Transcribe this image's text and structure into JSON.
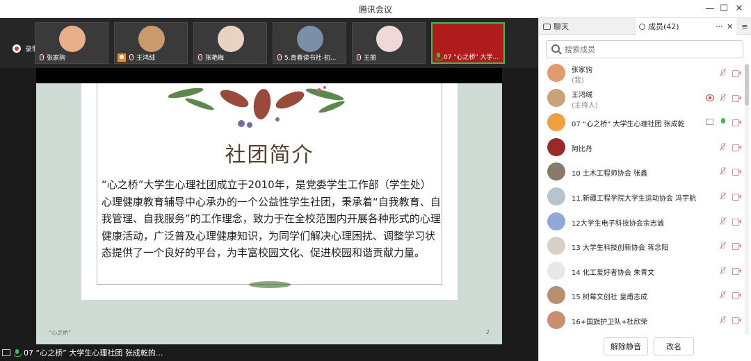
{
  "window": {
    "title": "腾讯会议"
  },
  "recording": {
    "label": "录制中"
  },
  "video_strip": [
    {
      "name": "张家驹",
      "avatar_color": "#e8b08a",
      "host": false,
      "active": false
    },
    {
      "name": "王鸿绒",
      "avatar_color": "#c99a6a",
      "host": true,
      "active": false
    },
    {
      "name": "张艳梅",
      "avatar_color": "#e8d2c4",
      "host": false,
      "active": false
    },
    {
      "name": "5.青春读书社-初...",
      "avatar_color": "#7b8fa6",
      "host": false,
      "active": false
    },
    {
      "name": "王丽",
      "avatar_color": "#efd8d8",
      "host": false,
      "active": false
    },
    {
      "name": "07 \"心之桥\" 大学...",
      "avatar_color": "#b01c1c",
      "host": false,
      "active": true
    }
  ],
  "slide": {
    "title": "社团简介",
    "body": "“心之桥”大学生心理社团成立于2010年，是党委学生工作部（学生处）心理健康教育辅导中心承办的一个公益性学生社团，秉承着“自我教育、自我管理、自我服务”的工作理念，致力于在全校范围内开展各种形式的心理健康活动，广泛普及心理健康知识，为同学们解决心理困扰、调整学习状态提供了一个良好的平台，为丰富校园文化、促进校园和谐贡献力量。",
    "footer_left": "“心之桥”",
    "page_number": "2"
  },
  "speaker": {
    "label": "07 “心之桥” 大学生心理社团  张成乾的..."
  },
  "panel": {
    "tab_chat": "聊天",
    "tab_members": "成员(42)",
    "more": "···",
    "close": "✕",
    "menu": "≡",
    "search_placeholder": "搜索成员",
    "members": [
      {
        "name": "张家驹",
        "role": "(我)",
        "avatar_color": "#e39a6c",
        "state": "muted"
      },
      {
        "name": "王鸿绒",
        "role": "(主持人)",
        "avatar_color": "#c9a27a",
        "state": "host"
      },
      {
        "name": "07 “心之桥” 大学生心理社团  张成乾",
        "role": "",
        "avatar_color": "#f0a040",
        "state": "speaking"
      },
      {
        "name": "阿比丹",
        "role": "",
        "avatar_color": "#9a2a2a",
        "state": "muted"
      },
      {
        "name": "10 土木工程师协会 张鑫",
        "role": "",
        "avatar_color": "#8a7a6a",
        "state": "muted"
      },
      {
        "name": "11.新疆工程学院大学生运动协会 冯宇航",
        "role": "",
        "avatar_color": "#b8c4cc",
        "state": "muted"
      },
      {
        "name": "12大学生电子科技协会余志诚",
        "role": "",
        "avatar_color": "#8fa8d8",
        "state": "muted"
      },
      {
        "name": "13 大学生科技创新协会 蒋念阳",
        "role": "",
        "avatar_color": "#d8d0c8",
        "state": "muted"
      },
      {
        "name": "14 化工爱好者协会 朱青文",
        "role": "",
        "avatar_color": "#e8e8e8",
        "state": "muted"
      },
      {
        "name": "15 树莓文创社 皇甫志成",
        "role": "",
        "avatar_color": "#b89070",
        "state": "muted"
      },
      {
        "name": "16+国旗护卫队+杜欣荣",
        "role": "",
        "avatar_color": "#c89070",
        "state": "muted"
      }
    ],
    "btn_unmute_all": "解除静音",
    "btn_rename": "改名"
  }
}
